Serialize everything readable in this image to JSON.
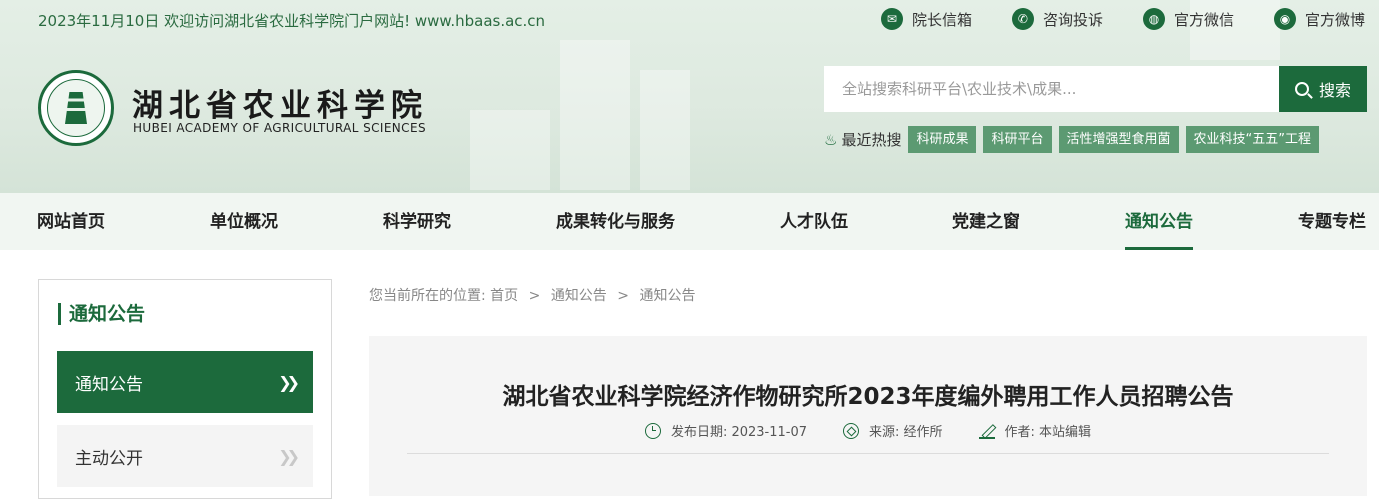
{
  "topbar": {
    "welcome": "2023年11月10日 欢迎访问湖北省农业科学院门户网站! www.hbaas.ac.cn",
    "links": [
      {
        "label": "院长信箱",
        "icon": "mail-icon",
        "glyph": "✉"
      },
      {
        "label": "咨询投诉",
        "icon": "phone-icon",
        "glyph": "✆"
      },
      {
        "label": "官方微信",
        "icon": "wechat-icon",
        "glyph": "◍"
      },
      {
        "label": "官方微博",
        "icon": "weibo-icon",
        "glyph": "◉"
      }
    ]
  },
  "logo": {
    "cn": "湖北省农业科学院",
    "en": "HUBEI ACADEMY OF AGRICULTURAL SCIENCES"
  },
  "search": {
    "placeholder": "全站搜索科研平台\\农业技术\\成果...",
    "button": "搜索"
  },
  "hot": {
    "label": "最近热搜",
    "tags": [
      "科研成果",
      "科研平台",
      "活性增强型食用菌",
      "农业科技“五五”工程"
    ]
  },
  "nav": {
    "items": [
      "网站首页",
      "单位概况",
      "科学研究",
      "成果转化与服务",
      "人才队伍",
      "党建之窗",
      "通知公告",
      "专题专栏"
    ],
    "active": "通知公告"
  },
  "sidebar": {
    "title": "通知公告",
    "items": [
      "通知公告",
      "主动公开"
    ],
    "chevron": "»"
  },
  "breadcrumb": {
    "prefix": "您当前所在的位置:",
    "items": [
      "首页",
      "通知公告",
      "通知公告"
    ],
    "separator": ">"
  },
  "article": {
    "title": "湖北省农业科学院经济作物研究所2023年度编外聘用工作人员招聘公告",
    "date": "发布日期: 2023-11-07",
    "source": "来源: 经作所",
    "author": "作者: 本站编辑"
  },
  "colors": {
    "brand": "#1c6a3c",
    "tag": "#5c9a72"
  }
}
